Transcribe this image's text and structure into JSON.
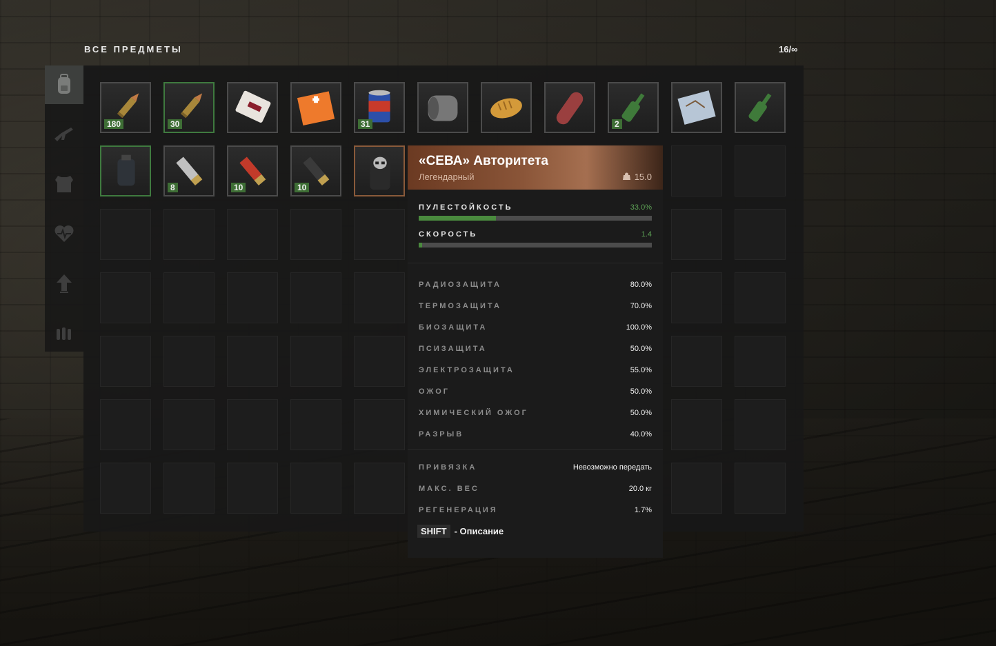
{
  "header": {
    "title": "ВСЕ ПРЕДМЕТЫ",
    "count": "16/∞"
  },
  "sidebar": {
    "tabs": [
      {
        "icon": "backpack-icon",
        "active": true
      },
      {
        "icon": "rifle-icon",
        "active": false
      },
      {
        "icon": "armor-icon",
        "active": false
      },
      {
        "icon": "heartbeat-icon",
        "active": false
      },
      {
        "icon": "arrow-up-icon",
        "active": false
      },
      {
        "icon": "ammo-icon",
        "active": false
      }
    ]
  },
  "inventory": {
    "items": [
      {
        "name": "rifle-cartridge",
        "count": "180",
        "border": "grey",
        "icon": "bullet-icon"
      },
      {
        "name": "rifle-cartridge-ap",
        "count": "30",
        "border": "green",
        "icon": "bullet-icon"
      },
      {
        "name": "pill-pack",
        "count": "",
        "border": "grey",
        "icon": "pills-icon"
      },
      {
        "name": "medkit",
        "count": "",
        "border": "grey",
        "icon": "medkit-icon"
      },
      {
        "name": "canned-food",
        "count": "31",
        "border": "grey",
        "icon": "can-icon"
      },
      {
        "name": "bandage-roll",
        "count": "",
        "border": "grey",
        "icon": "bandage-icon"
      },
      {
        "name": "bread",
        "count": "",
        "border": "grey",
        "icon": "bread-icon"
      },
      {
        "name": "sausage",
        "count": "",
        "border": "grey",
        "icon": "sausage-icon"
      },
      {
        "name": "beer-bottle",
        "count": "2",
        "border": "grey",
        "icon": "bottle-icon"
      },
      {
        "name": "map",
        "count": "",
        "border": "grey",
        "icon": "map-icon"
      },
      {
        "name": "cognac-bottle",
        "count": "",
        "border": "grey",
        "icon": "bottle-icon"
      },
      {
        "name": "grenade",
        "count": "",
        "border": "green",
        "icon": "grenade-icon"
      },
      {
        "name": "shotgun-shell-silver",
        "count": "8",
        "border": "grey",
        "icon": "shell-icon"
      },
      {
        "name": "shotgun-shell-red",
        "count": "10",
        "border": "grey",
        "icon": "shell-icon"
      },
      {
        "name": "shotgun-shell-black",
        "count": "10",
        "border": "grey",
        "icon": "shell-icon"
      },
      {
        "name": "seva-suit",
        "count": "",
        "border": "orange",
        "icon": "suit-icon"
      }
    ]
  },
  "tooltip": {
    "name": "«СЕВА» Авторитета",
    "rarity": "Легендарный",
    "weight": "15.0",
    "bars": [
      {
        "label": "ПУЛЕСТОЙКОСТЬ",
        "value": "33.0%",
        "fill": 0.33
      },
      {
        "label": "СКОРОСТЬ",
        "value": "1.4",
        "fill": 0.014
      }
    ],
    "protections": [
      {
        "label": "РАДИОЗАЩИТА",
        "value": "80.0%"
      },
      {
        "label": "ТЕРМОЗАЩИТА",
        "value": "70.0%"
      },
      {
        "label": "БИОЗАЩИТА",
        "value": "100.0%"
      },
      {
        "label": "ПСИЗАЩИТА",
        "value": "50.0%"
      },
      {
        "label": "ЭЛЕКТРОЗАЩИТА",
        "value": "55.0%"
      },
      {
        "label": "ОЖОГ",
        "value": "50.0%"
      },
      {
        "label": "ХИМИЧЕСКИЙ ОЖОГ",
        "value": "50.0%"
      },
      {
        "label": "РАЗРЫВ",
        "value": "40.0%"
      }
    ],
    "extras": [
      {
        "label": "ПРИВЯЗКА",
        "value": "Невозможно передать"
      },
      {
        "label": "МАКС. ВЕС",
        "value": "20.0 кг"
      },
      {
        "label": "РЕГЕНЕРАЦИЯ",
        "value": "1.7%"
      }
    ],
    "shift_key": "SHIFT",
    "shift_desc": "- Описание"
  },
  "colors": {
    "accent_green": "#4a8a3e",
    "legendary": "#8a5538",
    "panel": "#181818"
  }
}
